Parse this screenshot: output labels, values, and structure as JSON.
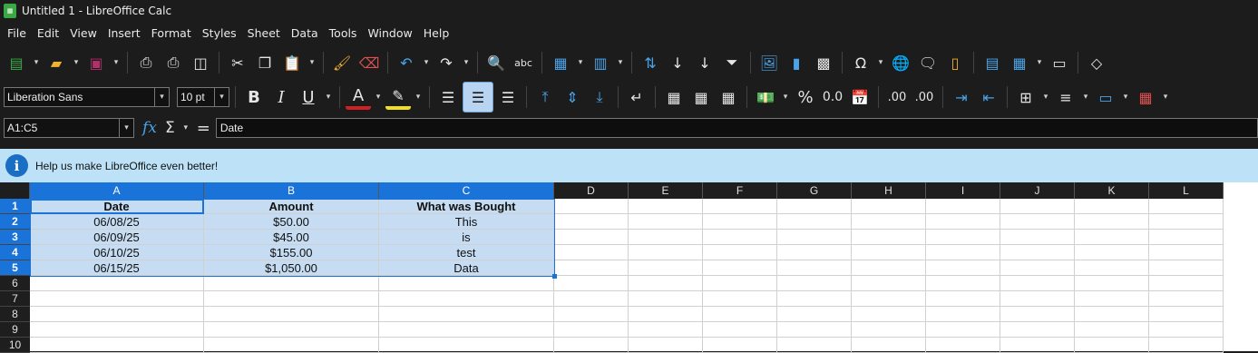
{
  "window": {
    "title": "Untitled 1 - LibreOffice Calc"
  },
  "menu": [
    "File",
    "Edit",
    "View",
    "Insert",
    "Format",
    "Styles",
    "Sheet",
    "Data",
    "Tools",
    "Window",
    "Help"
  ],
  "format": {
    "font_name": "Liberation Sans",
    "font_size": "10 pt"
  },
  "formula_bar": {
    "name_box": "A1:C5",
    "content": "Date"
  },
  "infobar": {
    "message": "Help us make LibreOffice even better!"
  },
  "columns": [
    "A",
    "B",
    "C",
    "D",
    "E",
    "F",
    "G",
    "H",
    "I",
    "J",
    "K",
    "L"
  ],
  "rows": [
    "1",
    "2",
    "3",
    "4",
    "5",
    "6",
    "7",
    "8",
    "9",
    "10"
  ],
  "cells": [
    [
      "Date",
      "Amount",
      "What was Bought"
    ],
    [
      "06/08/25",
      "$50.00",
      "This"
    ],
    [
      "06/09/25",
      "$45.00",
      "is"
    ],
    [
      "06/10/25",
      "$155.00",
      "test"
    ],
    [
      "06/15/25",
      "$1,050.00",
      "Data"
    ]
  ],
  "colors": {
    "selection": "#1a73d9",
    "selected_fill": "#c5dcf2",
    "infobar": "#bde2f7"
  }
}
